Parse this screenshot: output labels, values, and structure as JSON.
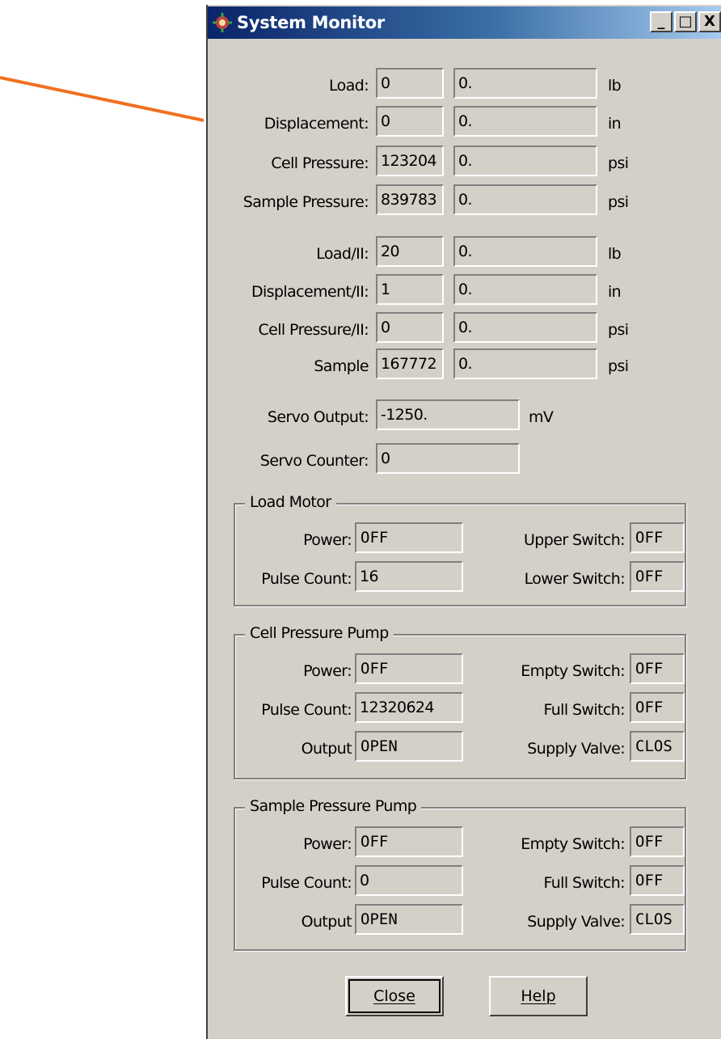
{
  "window": {
    "title": "System Monitor"
  },
  "title_buttons": {
    "minimize": "_",
    "maximize": "□",
    "close": "X"
  },
  "readings": [
    {
      "label": "Load:",
      "raw": "0",
      "value": "0.",
      "unit": "lb"
    },
    {
      "label": "Displacement:",
      "raw": "0",
      "value": "0.",
      "unit": "in"
    },
    {
      "label": "Cell Pressure:",
      "raw": "123204",
      "value": "0.",
      "unit": "psi"
    },
    {
      "label": "Sample Pressure:",
      "raw": "839783",
      "value": "0.",
      "unit": "psi"
    }
  ],
  "readings2": [
    {
      "label": "Load/II:",
      "raw": "20",
      "value": "0.",
      "unit": "lb"
    },
    {
      "label": "Displacement/II:",
      "raw": "1",
      "value": "0.",
      "unit": "in"
    },
    {
      "label": "Cell Pressure/II:",
      "raw": "0",
      "value": "0.",
      "unit": "psi"
    },
    {
      "label": "Sample",
      "raw": "167772",
      "value": "0.",
      "unit": "psi"
    }
  ],
  "servo": {
    "output_label": "Servo Output:",
    "output_value": "-1250.",
    "output_unit": "mV",
    "counter_label": "Servo Counter:",
    "counter_value": "0"
  },
  "load_motor": {
    "title": "Load Motor",
    "power_label": "Power:",
    "power": "OFF",
    "pulse_label": "Pulse Count:",
    "pulse": "16",
    "upper_label": "Upper Switch:",
    "upper": "OFF",
    "lower_label": "Lower Switch:",
    "lower": "OFF"
  },
  "cell_pump": {
    "title": "Cell Pressure Pump",
    "power_label": "Power:",
    "power": "OFF",
    "pulse_label": "Pulse Count:",
    "pulse": "12320624",
    "output_label": "Output",
    "output": "OPEN",
    "empty_label": "Empty Switch:",
    "empty": "OFF",
    "full_label": "Full Switch:",
    "full": "OFF",
    "supply_label": "Supply Valve:",
    "supply": "CLOS"
  },
  "sample_pump": {
    "title": "Sample Pressure Pump",
    "power_label": "Power:",
    "power": "OFF",
    "pulse_label": "Pulse Count:",
    "pulse": "0",
    "output_label": "Output",
    "output": "OPEN",
    "empty_label": "Empty Switch:",
    "empty": "OFF",
    "full_label": "Full Switch:",
    "full": "OFF",
    "supply_label": "Supply Valve:",
    "supply": "CLOS"
  },
  "buttons": {
    "close": "Close",
    "help": "Help"
  },
  "colors": {
    "annotation": "#f07020",
    "titlebar": "#0a246a",
    "face": "#d4d0c8"
  }
}
